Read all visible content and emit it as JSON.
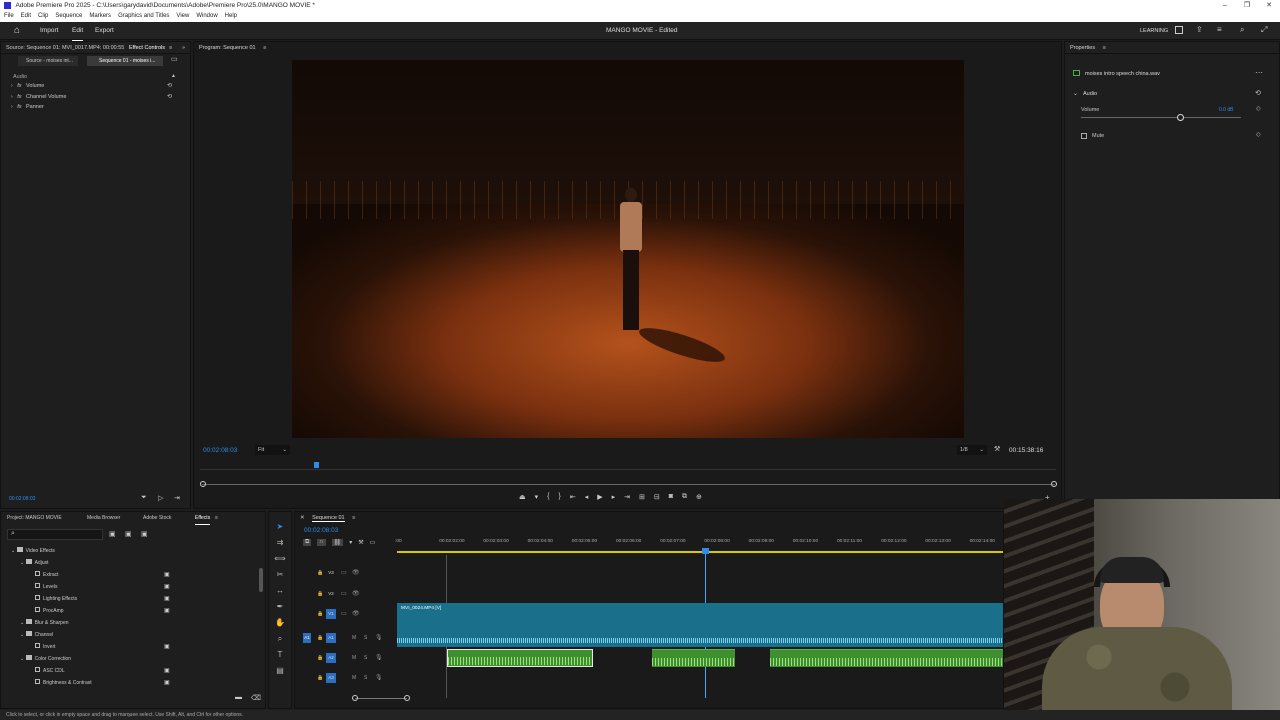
{
  "titlebar": {
    "title": "Adobe Premiere Pro 2025 - C:\\Users\\garydavid\\Documents\\Adobe\\Premiere Pro\\25.0\\MANGO MOVIE *"
  },
  "menu": [
    "File",
    "Edit",
    "Clip",
    "Sequence",
    "Markers",
    "Graphics and Titles",
    "View",
    "Window",
    "Help"
  ],
  "workspaces": {
    "import": "Import",
    "edit": "Edit",
    "export": "Export"
  },
  "project_title": "MANGO MOVIE - Edited",
  "top_right": {
    "learning": "LEARNING"
  },
  "effect_controls": {
    "tab_source": "Source: Sequence 01: MVI_0017.MP4: 00:00:55:01",
    "tab_ec": "Effect Controls",
    "subtab_source": "Source - moises int...",
    "subtab_seq": "Sequence 01 - moises i...",
    "section": "Audio",
    "rows": [
      "Volume",
      "Channel Volume",
      "Panner"
    ],
    "timecode": "00:02:08:03"
  },
  "program": {
    "tab": "Program: Sequence 01",
    "timecode": "00:02:08:03",
    "fit": "Fit",
    "res": "1/8",
    "duration": "00:15:38:16"
  },
  "properties": {
    "tab": "Properties",
    "file": "moises intro speech china.wav",
    "section": "Audio",
    "volume_label": "Volume",
    "volume_value": "0.0 dB",
    "mute_label": "Mute",
    "volume_level": 0.62
  },
  "project_panel": {
    "tabs": [
      "Project: MANGO MOVIE",
      "Media Browser",
      "Adobe Stock",
      "Effects"
    ],
    "tree": [
      {
        "label": "Video Effects",
        "indent": 0,
        "folder": true
      },
      {
        "label": "Adjust",
        "indent": 1,
        "folder": true
      },
      {
        "label": "Extract",
        "indent": 2,
        "folder": false
      },
      {
        "label": "Levels",
        "indent": 2,
        "folder": false
      },
      {
        "label": "Lighting Effects",
        "indent": 2,
        "folder": false
      },
      {
        "label": "ProcAmp",
        "indent": 2,
        "folder": false
      },
      {
        "label": "Blur & Sharpen",
        "indent": 1,
        "folder": true
      },
      {
        "label": "Channel",
        "indent": 1,
        "folder": true
      },
      {
        "label": "Invert",
        "indent": 2,
        "folder": false
      },
      {
        "label": "Color Correction",
        "indent": 1,
        "folder": true
      },
      {
        "label": "ASC CDL",
        "indent": 2,
        "folder": false
      },
      {
        "label": "Brightness & Contrast",
        "indent": 2,
        "folder": false
      }
    ]
  },
  "timeline": {
    "tab": "Sequence 01",
    "timecode": "00:02:08:03",
    "ruler": [
      ":00",
      "00:02:02:00",
      "00:02:03:00",
      "00:02:04:00",
      "00:02:05:00",
      "00:02:06:00",
      "00:02:07:00",
      "00:02:08:00",
      "00:02:09:00",
      "00:02:10:00",
      "00:02:11:00",
      "00:02:12:00",
      "00:02:13:00",
      "00:02:14:00",
      "00:"
    ],
    "tracks": [
      "V3",
      "V2",
      "V1",
      "A1",
      "A2",
      "A3"
    ],
    "video_clip": "MVI_0024.MP4 [V]"
  },
  "status": "Click to select, or click in empty space and drag to marquee select. Use Shift, Alt, and Ctrl for other options.",
  "colors": {
    "accent": "#2d8ceb",
    "video_clip": "#1a6f8a",
    "audio_clip": "#3f8f2f"
  }
}
